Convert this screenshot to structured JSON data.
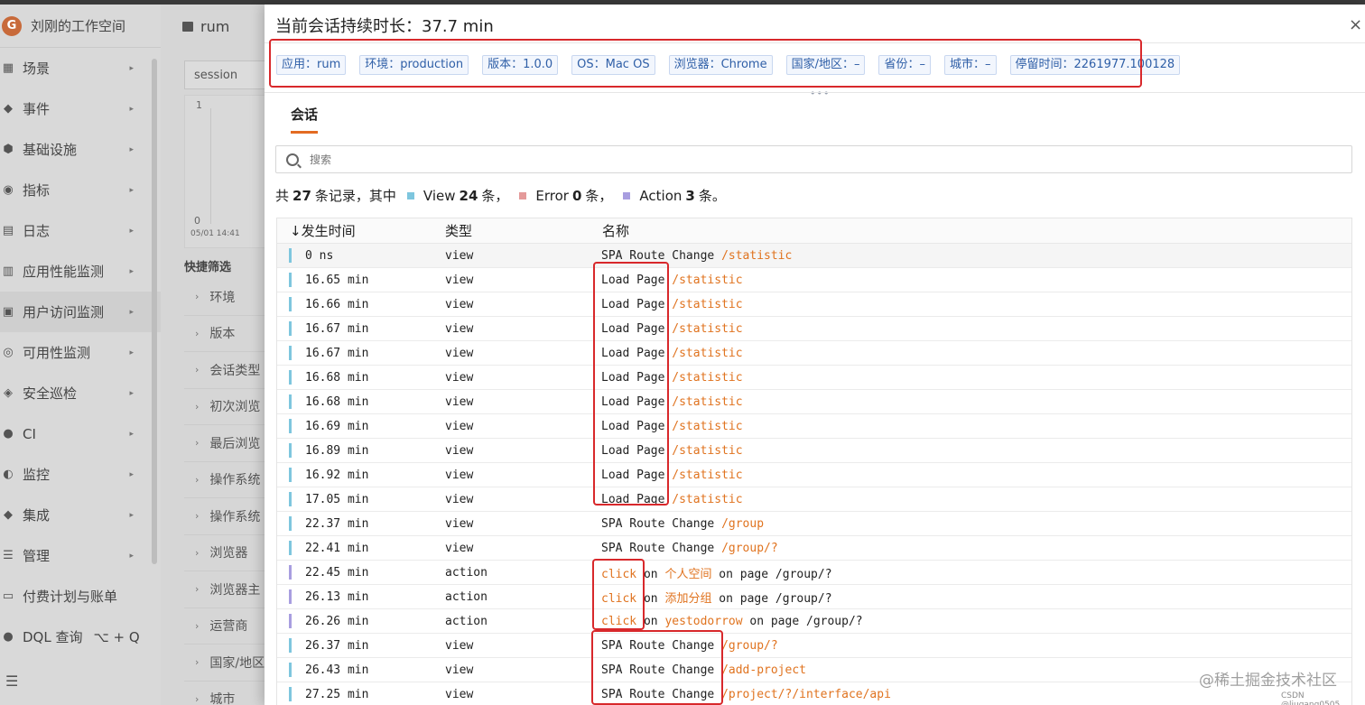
{
  "background": {
    "workspace": "刘刚的工作空间",
    "nav": [
      {
        "label": "场景",
        "icon": "scene-icon"
      },
      {
        "label": "事件",
        "icon": "bell-icon"
      },
      {
        "label": "基础设施",
        "icon": "infra-icon"
      },
      {
        "label": "指标",
        "icon": "metrics-icon"
      },
      {
        "label": "日志",
        "icon": "log-icon"
      },
      {
        "label": "应用性能监测",
        "icon": "apm-icon"
      },
      {
        "label": "用户访问监测",
        "icon": "rum-icon"
      },
      {
        "label": "可用性监测",
        "icon": "availability-icon"
      },
      {
        "label": "安全巡检",
        "icon": "security-icon"
      },
      {
        "label": "CI",
        "icon": "ci-icon"
      },
      {
        "label": "监控",
        "icon": "monitor-icon"
      },
      {
        "label": "集成",
        "icon": "integration-icon"
      },
      {
        "label": "管理",
        "icon": "manage-icon"
      },
      {
        "label": "付费计划与账单",
        "icon": "billing-icon"
      },
      {
        "label": "DQL 查询",
        "icon": "dql-icon",
        "shortcut": "⌥ + Q"
      }
    ],
    "app_name": "rum",
    "session_select": "session",
    "chart_top": "1",
    "chart_bottom": "0",
    "chart_date": "05/01 14:41",
    "quick_filter": "快捷筛选",
    "filters": [
      "环境",
      "版本",
      "会话类型",
      "初次浏览",
      "最后浏览",
      "操作系统",
      "操作系统",
      "浏览器",
      "浏览器主",
      "运营商",
      "国家/地区",
      "城市"
    ]
  },
  "drawer": {
    "title": "当前会话持续时长：37.7 min",
    "close": "×",
    "tags": [
      "应用：rum",
      "环境：production",
      "版本：1.0.0",
      "OS：Mac OS",
      "浏览器：Chrome",
      "国家/地区：–",
      "省份：–",
      "城市：–",
      "停留时间：2261977.100128"
    ],
    "tab": "会话",
    "search_placeholder": "搜索",
    "summary": {
      "prefix": "共",
      "total": "27",
      "mid": "条记录，其中",
      "view_label": "View",
      "view_count": "24",
      "view_unit": "条，",
      "error_label": "Error",
      "error_count": "0",
      "error_unit": "条，",
      "action_label": "Action",
      "action_count": "3",
      "action_unit": "条。"
    },
    "colors": {
      "view": "#7ec6de",
      "error": "#e49a9a",
      "action": "#a89ee0",
      "accent": "#e36b22",
      "link": "#e0731f"
    },
    "columns": {
      "time": "↓发生时间",
      "type": "类型",
      "name": "名称"
    },
    "rows": [
      {
        "time": "0 ns",
        "type": "view",
        "kind": "view",
        "name": "SPA Route Change",
        "path": "/statistic"
      },
      {
        "time": "16.65 min",
        "type": "view",
        "kind": "view",
        "name": "Load Page",
        "path": "/statistic"
      },
      {
        "time": "16.66 min",
        "type": "view",
        "kind": "view",
        "name": "Load Page",
        "path": "/statistic"
      },
      {
        "time": "16.67 min",
        "type": "view",
        "kind": "view",
        "name": "Load Page",
        "path": "/statistic"
      },
      {
        "time": "16.67 min",
        "type": "view",
        "kind": "view",
        "name": "Load Page",
        "path": "/statistic"
      },
      {
        "time": "16.68 min",
        "type": "view",
        "kind": "view",
        "name": "Load Page",
        "path": "/statistic"
      },
      {
        "time": "16.68 min",
        "type": "view",
        "kind": "view",
        "name": "Load Page",
        "path": "/statistic"
      },
      {
        "time": "16.69 min",
        "type": "view",
        "kind": "view",
        "name": "Load Page",
        "path": "/statistic"
      },
      {
        "time": "16.89 min",
        "type": "view",
        "kind": "view",
        "name": "Load Page",
        "path": "/statistic"
      },
      {
        "time": "16.92 min",
        "type": "view",
        "kind": "view",
        "name": "Load Page",
        "path": "/statistic"
      },
      {
        "time": "17.05 min",
        "type": "view",
        "kind": "view",
        "name": "Load Page",
        "path": "/statistic"
      },
      {
        "time": "22.37 min",
        "type": "view",
        "kind": "view",
        "name": "SPA Route Change",
        "path": "/group"
      },
      {
        "time": "22.41 min",
        "type": "view",
        "kind": "view",
        "name": "SPA Route Change",
        "path": "/group/?"
      },
      {
        "time": "22.45 min",
        "type": "action",
        "kind": "action",
        "verb": "click",
        "on": "on",
        "target": "个人空间",
        "on_page": "on page",
        "path": "/group/?"
      },
      {
        "time": "26.13 min",
        "type": "action",
        "kind": "action",
        "verb": "click",
        "on": "on",
        "target": "添加分组",
        "on_page": "on page",
        "path": "/group/?"
      },
      {
        "time": "26.26 min",
        "type": "action",
        "kind": "action",
        "verb": "click",
        "on": "on",
        "target": "yestodorrow",
        "on_page": "on page",
        "path": "/group/?"
      },
      {
        "time": "26.37 min",
        "type": "view",
        "kind": "view",
        "name": "SPA Route Change",
        "path": "/group/?"
      },
      {
        "time": "26.43 min",
        "type": "view",
        "kind": "view",
        "name": "SPA Route Change",
        "path": "/add-project"
      },
      {
        "time": "27.25 min",
        "type": "view",
        "kind": "view",
        "name": "SPA Route Change",
        "path": "/project/?/interface/api"
      }
    ]
  },
  "watermark": "@稀土掘金技术社区",
  "csdn_watermark": "CSDN @liugang0505"
}
